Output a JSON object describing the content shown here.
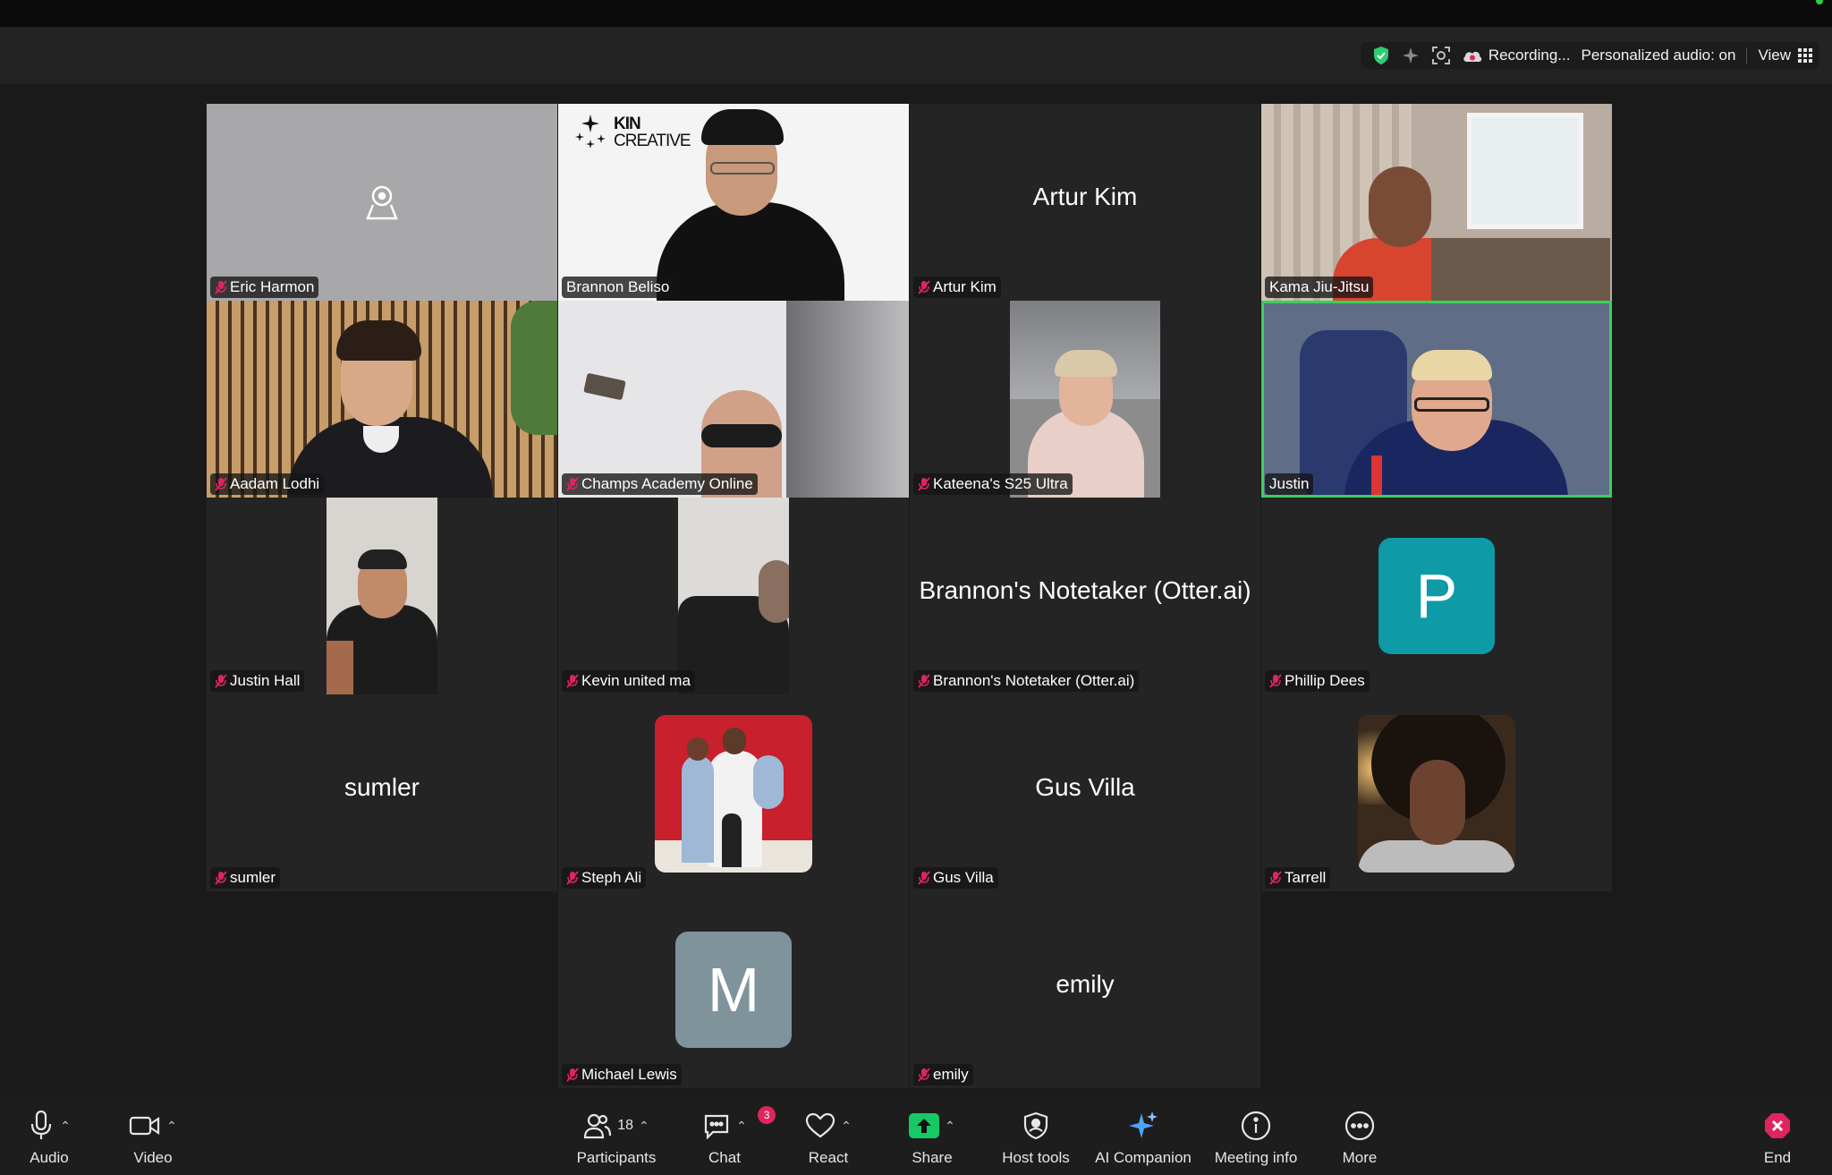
{
  "header": {
    "recording_label": "Recording...",
    "personalized_audio_label": "Personalized audio: on",
    "view_label": "View"
  },
  "tiles": [
    {
      "name": "Eric Harmon",
      "muted": true,
      "display": "camera-off-icon"
    },
    {
      "name": "Brannon Beliso",
      "muted": false,
      "display": "video",
      "overlay_logo_line1": "KIN",
      "overlay_logo_line2": "CREATIVE"
    },
    {
      "name": "Artur Kim",
      "muted": true,
      "display": "name",
      "big_name": "Artur Kim"
    },
    {
      "name": "Kama Jiu-Jitsu",
      "muted": false,
      "display": "video"
    },
    {
      "name": "Aadam Lodhi",
      "muted": true,
      "display": "video"
    },
    {
      "name": "Champs Academy Online",
      "muted": true,
      "display": "video"
    },
    {
      "name": "Kateena's S25 Ultra",
      "muted": true,
      "display": "video"
    },
    {
      "name": "Justin",
      "muted": false,
      "display": "video",
      "active_speaker": true
    },
    {
      "name": "Justin Hall",
      "muted": true,
      "display": "video"
    },
    {
      "name": "Kevin united ma",
      "muted": true,
      "display": "video"
    },
    {
      "name": "Brannon's Notetaker (Otter.ai)",
      "muted": true,
      "display": "name",
      "big_name": "Brannon's Notetaker (Otter.ai)"
    },
    {
      "name": "Phillip Dees",
      "muted": true,
      "display": "letter",
      "letter": "P",
      "color": "#0e9aa7"
    },
    {
      "name": "sumler",
      "muted": true,
      "display": "name",
      "big_name": "sumler"
    },
    {
      "name": "Steph Ali",
      "muted": true,
      "display": "photo"
    },
    {
      "name": "Gus Villa",
      "muted": true,
      "display": "name",
      "big_name": "Gus Villa"
    },
    {
      "name": "Tarrell",
      "muted": true,
      "display": "photo"
    },
    {
      "name": "Michael Lewis",
      "muted": true,
      "display": "letter",
      "letter": "M",
      "color": "#7f939b"
    },
    {
      "name": "emily",
      "muted": true,
      "display": "name",
      "big_name": "emily"
    }
  ],
  "toolbar": {
    "audio_label": "Audio",
    "video_label": "Video",
    "participants_label": "Participants",
    "participants_count": "18",
    "chat_label": "Chat",
    "chat_badge": "3",
    "react_label": "React",
    "share_label": "Share",
    "host_tools_label": "Host tools",
    "ai_companion_label": "AI Companion",
    "meeting_info_label": "Meeting info",
    "more_label": "More",
    "end_label": "End"
  },
  "colors": {
    "active_speaker": "#3ad15a",
    "share_green": "#17c964",
    "end_red": "#e0245e",
    "shield_green": "#2ecc71"
  }
}
